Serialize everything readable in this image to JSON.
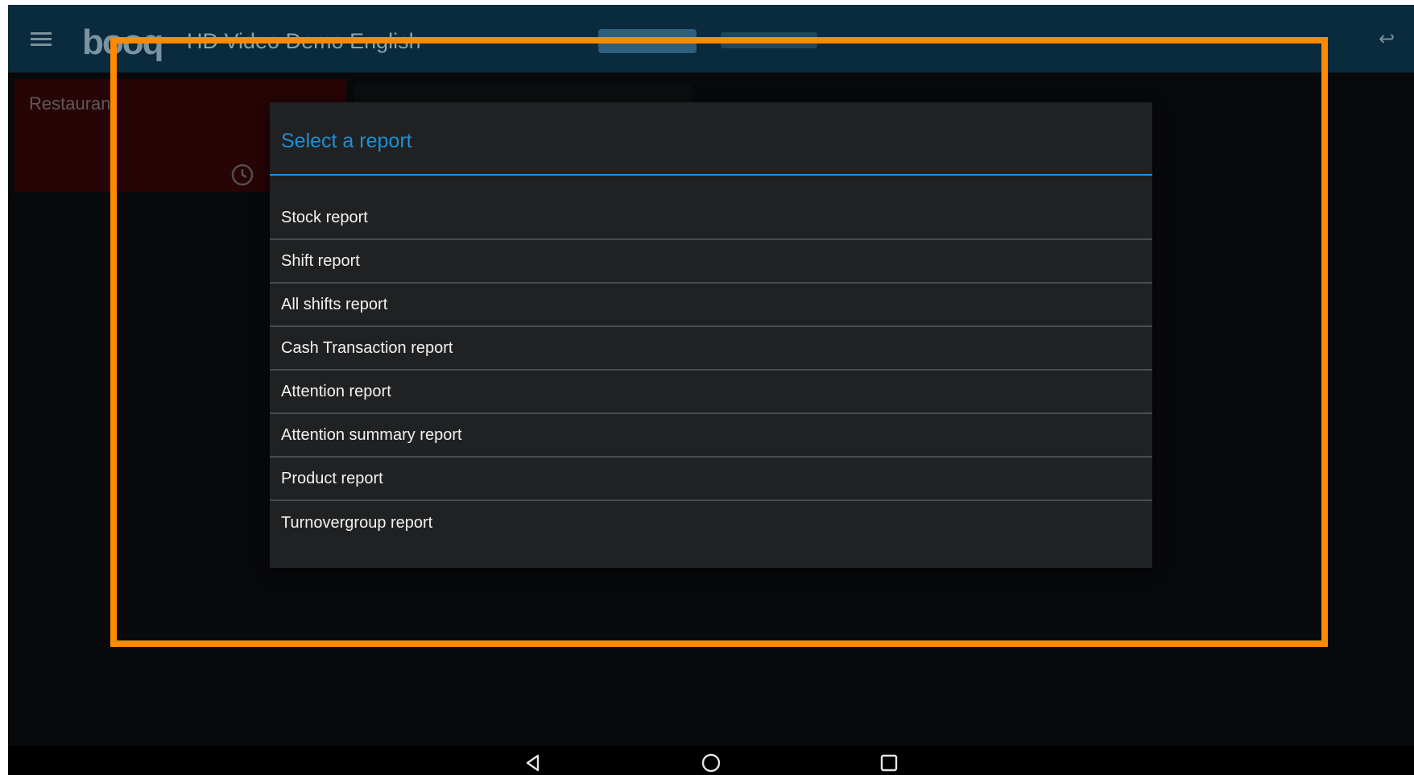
{
  "app": {
    "title": "HD Video Demo English",
    "logo_text": "booq",
    "icons": {
      "menu": "hamburger-menu-icon",
      "back": "undo-arrow-icon",
      "clock": "clock-icon"
    }
  },
  "background": {
    "restaurant_label": "Restaurant"
  },
  "dialog": {
    "title": "Select a report",
    "accent_color": "#1e8fd6",
    "items": [
      {
        "label": "Stock report"
      },
      {
        "label": "Shift report"
      },
      {
        "label": "All shifts report"
      },
      {
        "label": "Cash Transaction report"
      },
      {
        "label": "Attention report"
      },
      {
        "label": "Attention summary report"
      },
      {
        "label": "Product report"
      },
      {
        "label": "Turnovergroup report"
      }
    ]
  },
  "highlight": {
    "color": "#ff8a00"
  },
  "navbar": {
    "buttons": [
      "back-triangle-icon",
      "home-circle-icon",
      "recents-square-icon"
    ]
  }
}
